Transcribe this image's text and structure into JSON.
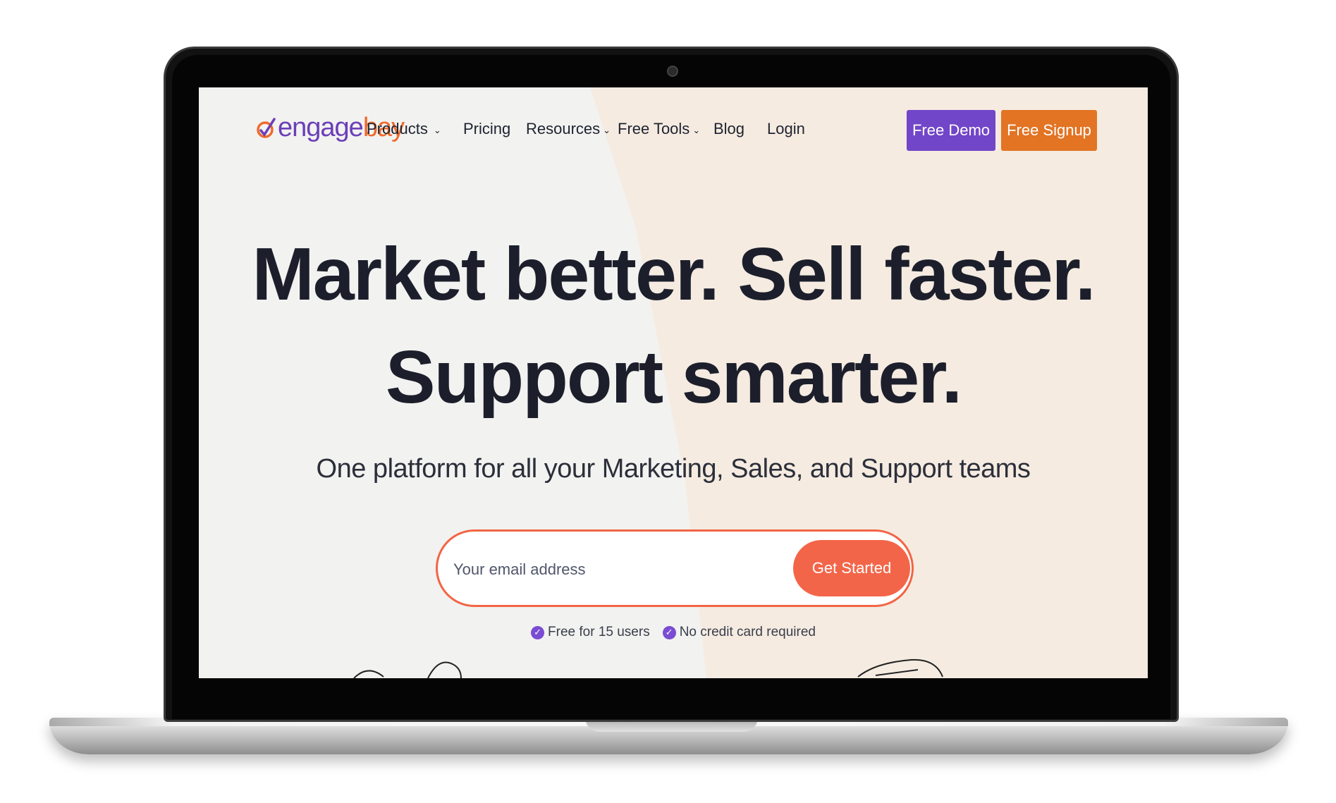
{
  "brand": {
    "name_part1": "engage",
    "name_part2": "bay",
    "color_purple": "#6b3fb8",
    "color_orange": "#ef6a2d"
  },
  "nav": {
    "items": [
      {
        "label": "Products",
        "has_dropdown": true
      },
      {
        "label": "Pricing",
        "has_dropdown": false
      },
      {
        "label": "Resources",
        "has_dropdown": true
      },
      {
        "label": "Free Tools",
        "has_dropdown": true
      },
      {
        "label": "Blog",
        "has_dropdown": false
      },
      {
        "label": "Login",
        "has_dropdown": false
      }
    ],
    "demo_button": "Free Demo",
    "signup_button": "Free Signup",
    "demo_color": "#7246c8",
    "signup_color": "#e27424"
  },
  "hero": {
    "headline_line1": "Market better. Sell faster.",
    "headline_line2": "Support smarter.",
    "subheadline": "One platform for all your Marketing, Sales, and Support teams",
    "email_placeholder": "Your email address",
    "cta_button": "Get Started",
    "cta_color": "#f36549",
    "perks": [
      "Free for 15 users",
      "No credit card required"
    ]
  },
  "icons": {
    "dropdown": "chevron-down-icon",
    "check": "check-circle-icon",
    "camera": "webcam-icon"
  }
}
